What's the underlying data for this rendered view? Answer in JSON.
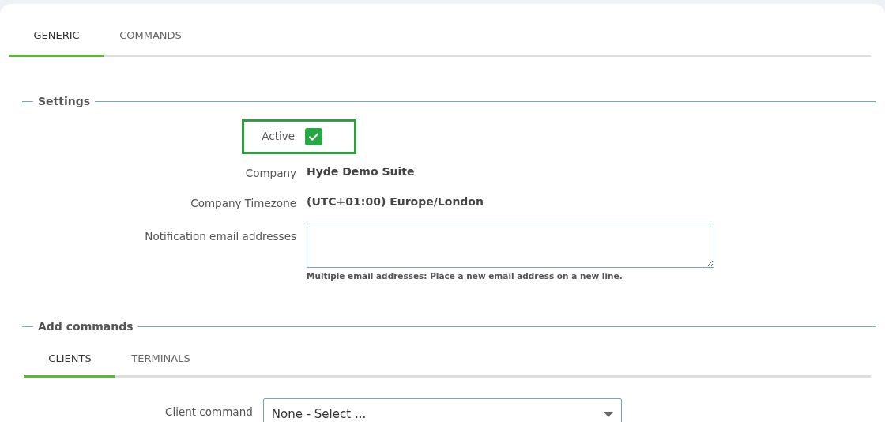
{
  "tabs": [
    {
      "label": "GENERIC",
      "selected": true
    },
    {
      "label": "COMMANDS",
      "selected": false
    }
  ],
  "settings": {
    "legend": "Settings",
    "active": {
      "label": "Active",
      "checked": true,
      "highlighted": true
    },
    "fields": [
      {
        "label": "Company",
        "value": "Hyde Demo Suite"
      },
      {
        "label": "Company Timezone",
        "value": "(UTC+01:00) Europe/London"
      }
    ],
    "notification": {
      "label": "Notification email addresses",
      "hint": "Multiple email addresses: Place a new email address on a new line."
    }
  },
  "add_commands": {
    "legend": "Add commands",
    "tabs": [
      {
        "label": "CLIENTS",
        "selected": true
      },
      {
        "label": "TERMINALS",
        "selected": false
      }
    ],
    "select": {
      "label": "Client command",
      "value": "None - Select ..."
    }
  }
}
